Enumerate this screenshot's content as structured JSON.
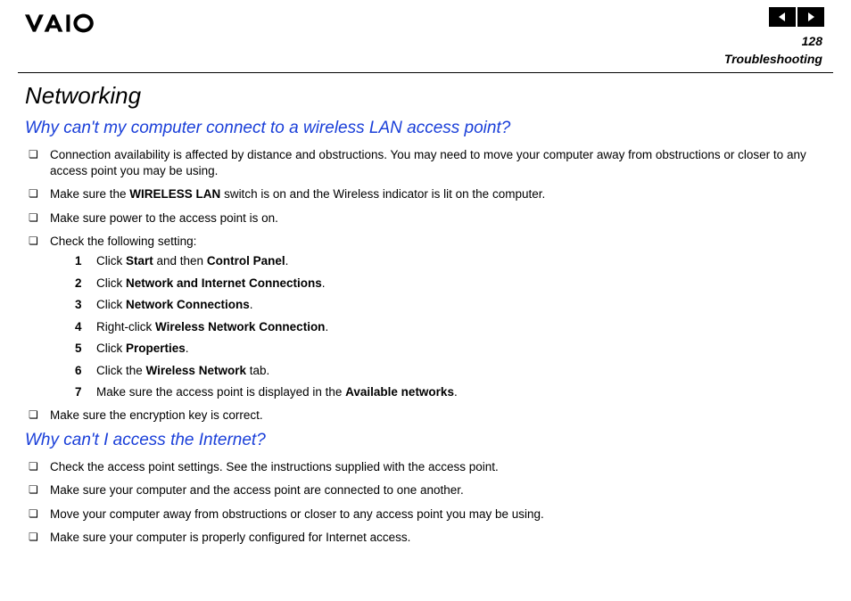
{
  "header": {
    "pageNumber": "128",
    "sectionName": "Troubleshooting"
  },
  "title": "Networking",
  "q1": {
    "heading": "Why can't my computer connect to a wireless LAN access point?",
    "bullets": {
      "b1": "Connection availability is affected by distance and obstructions. You may need to move your computer away from obstructions or closer to any access point you may be using.",
      "b2a": "Make sure the ",
      "b2b": "WIRELESS LAN",
      "b2c": " switch is on and the Wireless indicator is lit on the computer.",
      "b3": "Make sure power to the access point is on.",
      "b4": "Check the following setting:",
      "b5": "Make sure the encryption key is correct."
    },
    "steps": {
      "s1a": "Click ",
      "s1b": "Start",
      "s1c": " and then ",
      "s1d": "Control Panel",
      "s1e": ".",
      "s2a": "Click ",
      "s2b": "Network and Internet Connections",
      "s2c": ".",
      "s3a": "Click ",
      "s3b": "Network Connections",
      "s3c": ".",
      "s4a": "Right-click ",
      "s4b": "Wireless Network Connection",
      "s4c": ".",
      "s5a": "Click ",
      "s5b": "Properties",
      "s5c": ".",
      "s6a": "Click the ",
      "s6b": "Wireless Network",
      "s6c": " tab.",
      "s7a": "Make sure the access point is displayed in the ",
      "s7b": "Available networks",
      "s7c": "."
    },
    "nums": {
      "n1": "1",
      "n2": "2",
      "n3": "3",
      "n4": "4",
      "n5": "5",
      "n6": "6",
      "n7": "7"
    }
  },
  "q2": {
    "heading": "Why can't I access the Internet?",
    "bullets": {
      "b1": "Check the access point settings. See the instructions supplied with the access point.",
      "b2": "Make sure your computer and the access point are connected to one another.",
      "b3": "Move your computer away from obstructions or closer to any access point you may be using.",
      "b4": "Make sure your computer is properly configured for Internet access."
    }
  }
}
